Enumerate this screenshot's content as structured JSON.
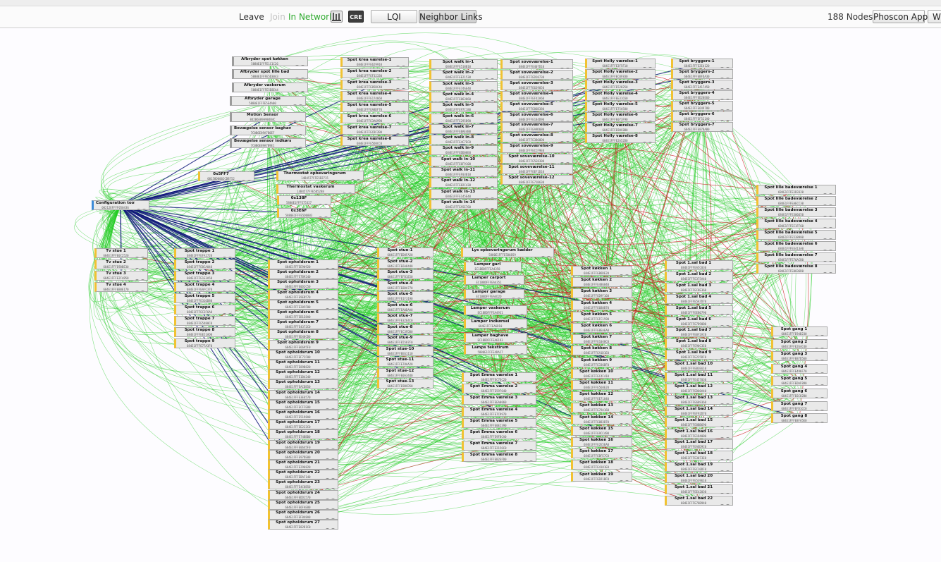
{
  "toolbar": {
    "leave": "Leave",
    "join": "Join",
    "network_status": "In Network",
    "cre_icon_label": "CRE",
    "lqi": "LQI",
    "neighbor_links": "Neighbor Links",
    "node_count": "188 Nodes",
    "phoscon_app": "Phoscon App",
    "extra_button": "W"
  },
  "colors": {
    "router_marker": "#f1c232",
    "coordinator_marker": "#3c8bd8",
    "switch_marker": "#9c9c9c",
    "good_link": "#22cc22",
    "coordinator_link": "#101a7a",
    "weak_link": "#cc2222",
    "network_status": "#2eaa2e"
  },
  "icons": {
    "network_settings": "network-settings-icon",
    "cre": "cre-icon"
  },
  "groups": [
    {
      "prefix": "Spot krea værelse-",
      "count": 8
    },
    {
      "prefix": "Spot walk in-",
      "count": 14
    },
    {
      "prefix": "Spot soveværelse-",
      "count": 12
    },
    {
      "prefix": "Spot Holly værelse-",
      "count": 8
    },
    {
      "prefix": "Spot bryggers-",
      "count": 7
    },
    {
      "prefix": "Spot lille badeværelse ",
      "count": 8
    },
    {
      "prefix": "Tv stue ",
      "count": 4
    },
    {
      "prefix": "Spot trappe ",
      "count": 9
    },
    {
      "prefix": "Spot opholdsrum ",
      "count": 27
    },
    {
      "prefix": "Spot stue-",
      "count": 13
    },
    {
      "prefix": "Spot Emma værelse ",
      "count": 8
    },
    {
      "prefix": "Spot køkken ",
      "count": 19
    },
    {
      "prefix": "Spot 1.sal bad ",
      "count": 22
    },
    {
      "prefix": "Spot gang ",
      "count": 8
    }
  ],
  "nodes": {
    "afbryder_spot_kokken": {
      "name": "Afbryder spot køkken",
      "addr": "5880E1FFFE1C1C26"
    },
    "afbryder_spot_lille_bad": {
      "name": "Afbryder spot lille bad",
      "addr": "5880E1FFFE5D3043"
    },
    "afbryder_vaskerum": {
      "name": "Afbryder vaskerum",
      "addr": "5880E1FFFE5E8EA4"
    },
    "afbryder_garage": {
      "name": "Afbryder garage",
      "addr": "5880E1FFFE5E4A00"
    },
    "motion_sensor": {
      "name": "Motion Sensor",
      "addr": "842B6E89A9B4B4C"
    },
    "bevaegelse_baghave": {
      "name": "Bevægelse sensor baghave",
      "addr": "7C0B6E89A7B0EF"
    },
    "bevaegelse_indkorsel": {
      "name": "Bevægelse sensor indkørsel",
      "addr": "7C0B6E89A7B9E1"
    },
    "thermostat_opbevaringsrum": {
      "name": "Thermostat opbevaringsrum",
      "addr": "14B4577FFE5D2715"
    },
    "thermostat_vaskerum": {
      "name": "Thermostat vaskerum",
      "addr": "14B4577FFE5D5288"
    },
    "node_0x5ff7": {
      "name": "0x5FF7",
      "addr": "00158D0002CDB752"
    },
    "node_0x138f": {
      "name": "0x138F",
      "addr": "5880E1FFFE75327"
    },
    "node_0x3e6f": {
      "name": "0x3E6F",
      "addr": "5880E1FFFE5D6883"
    },
    "configuration_tool": {
      "name": "Configuration tool 1",
      "addr": "00212EFFFF050436"
    },
    "lys_opbevaringsrum_kaelder": {
      "name": "Lys opbevaringsrum kælder",
      "addr": "5880E1FFFE5D6859"
    },
    "lamper_garl": {
      "name": "Lamper garl",
      "addr": "EC1BBDFFFEA4358"
    },
    "lamper_carport": {
      "name": "Lamper carport",
      "addr": "EC1BBDFFFEA4351"
    },
    "lamper_garage": {
      "name": "Lamper garage",
      "addr": "EC1BBDFFFEA4D2D"
    },
    "lamper_vaskerum": {
      "name": "Lamper vaskerum",
      "addr": "EC1BBDFFFEA4931"
    },
    "lamper_indkorsel": {
      "name": "Lamper indkørsel",
      "addr": "684E1FFFEA6D10"
    },
    "lamper_baghave": {
      "name": "Lamper baghave",
      "addr": "EC1BBDFFFEA6193"
    },
    "lamps_tekstirum": {
      "name": "Lamps tekstirum",
      "addr": "5880E1FFFE4DA27"
    }
  }
}
